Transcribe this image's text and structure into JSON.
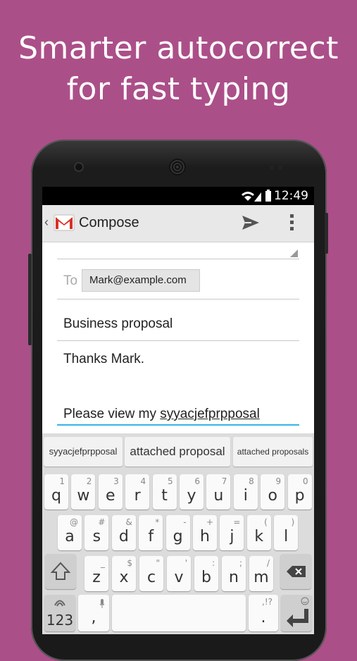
{
  "headline": {
    "line1": "Smarter autocorrect",
    "line2": "for fast typing"
  },
  "status": {
    "time": "12:49",
    "icons": [
      "wifi-icon",
      "signal-icon",
      "battery-icon"
    ]
  },
  "app": {
    "title": "Compose",
    "app_icon": "gmail-icon",
    "actions": [
      "send-icon",
      "overflow-menu-icon"
    ]
  },
  "compose": {
    "to_label": "To",
    "to_value": "Mark@example.com",
    "subject": "Business proposal",
    "body_line1": "Thanks Mark.",
    "body_line2_prefix": "Please view my ",
    "body_line2_typed": "syyacjefprpposal"
  },
  "keyboard": {
    "suggestions": [
      "syyacjefprpposal",
      "attached proposal",
      "attached proposals"
    ],
    "row1": [
      [
        "q",
        "1"
      ],
      [
        "w",
        "2"
      ],
      [
        "e",
        "3"
      ],
      [
        "r",
        "4"
      ],
      [
        "t",
        "5"
      ],
      [
        "y",
        "6"
      ],
      [
        "u",
        "7"
      ],
      [
        "i",
        "8"
      ],
      [
        "o",
        "9"
      ],
      [
        "p",
        "0"
      ]
    ],
    "row2": [
      [
        "a",
        "@"
      ],
      [
        "s",
        "#"
      ],
      [
        "d",
        "&"
      ],
      [
        "f",
        "*"
      ],
      [
        "g",
        "-"
      ],
      [
        "h",
        "+"
      ],
      [
        "j",
        "="
      ],
      [
        "k",
        "("
      ],
      [
        "l",
        ")"
      ]
    ],
    "row3": [
      [
        "z",
        "_"
      ],
      [
        "x",
        "$"
      ],
      [
        "c",
        "\""
      ],
      [
        "v",
        "'"
      ],
      [
        "b",
        ":"
      ],
      [
        "n",
        ";"
      ],
      [
        "m",
        "/"
      ]
    ],
    "numbers_label": "123",
    "comma": ",",
    "period": ".",
    "period_hint": ",!?"
  },
  "colors": {
    "background": "#ab4f89",
    "accent": "#33b5e5"
  }
}
